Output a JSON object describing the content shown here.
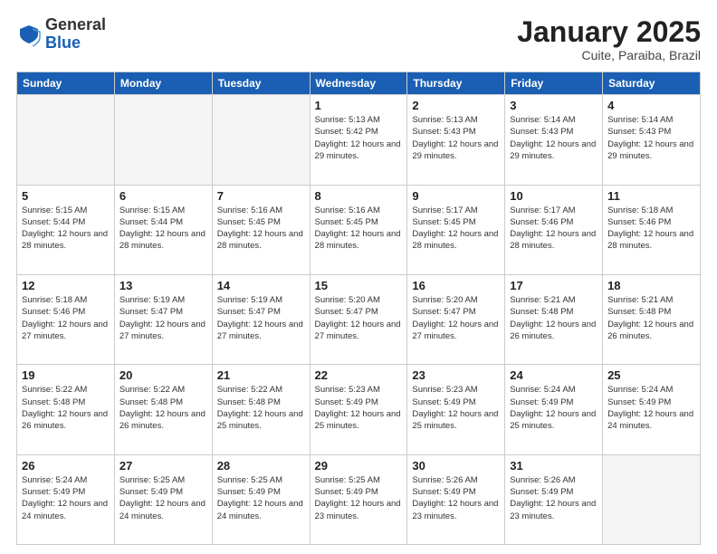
{
  "header": {
    "logo_general": "General",
    "logo_blue": "Blue",
    "month_title": "January 2025",
    "subtitle": "Cuite, Paraiba, Brazil"
  },
  "days_of_week": [
    "Sunday",
    "Monday",
    "Tuesday",
    "Wednesday",
    "Thursday",
    "Friday",
    "Saturday"
  ],
  "weeks": [
    [
      {
        "day": "",
        "sunrise": "",
        "sunset": "",
        "daylight": "",
        "empty": true
      },
      {
        "day": "",
        "sunrise": "",
        "sunset": "",
        "daylight": "",
        "empty": true
      },
      {
        "day": "",
        "sunrise": "",
        "sunset": "",
        "daylight": "",
        "empty": true
      },
      {
        "day": "1",
        "sunrise": "Sunrise: 5:13 AM",
        "sunset": "Sunset: 5:42 PM",
        "daylight": "Daylight: 12 hours and 29 minutes.",
        "empty": false
      },
      {
        "day": "2",
        "sunrise": "Sunrise: 5:13 AM",
        "sunset": "Sunset: 5:43 PM",
        "daylight": "Daylight: 12 hours and 29 minutes.",
        "empty": false
      },
      {
        "day": "3",
        "sunrise": "Sunrise: 5:14 AM",
        "sunset": "Sunset: 5:43 PM",
        "daylight": "Daylight: 12 hours and 29 minutes.",
        "empty": false
      },
      {
        "day": "4",
        "sunrise": "Sunrise: 5:14 AM",
        "sunset": "Sunset: 5:43 PM",
        "daylight": "Daylight: 12 hours and 29 minutes.",
        "empty": false
      }
    ],
    [
      {
        "day": "5",
        "sunrise": "Sunrise: 5:15 AM",
        "sunset": "Sunset: 5:44 PM",
        "daylight": "Daylight: 12 hours and 28 minutes.",
        "empty": false
      },
      {
        "day": "6",
        "sunrise": "Sunrise: 5:15 AM",
        "sunset": "Sunset: 5:44 PM",
        "daylight": "Daylight: 12 hours and 28 minutes.",
        "empty": false
      },
      {
        "day": "7",
        "sunrise": "Sunrise: 5:16 AM",
        "sunset": "Sunset: 5:45 PM",
        "daylight": "Daylight: 12 hours and 28 minutes.",
        "empty": false
      },
      {
        "day": "8",
        "sunrise": "Sunrise: 5:16 AM",
        "sunset": "Sunset: 5:45 PM",
        "daylight": "Daylight: 12 hours and 28 minutes.",
        "empty": false
      },
      {
        "day": "9",
        "sunrise": "Sunrise: 5:17 AM",
        "sunset": "Sunset: 5:45 PM",
        "daylight": "Daylight: 12 hours and 28 minutes.",
        "empty": false
      },
      {
        "day": "10",
        "sunrise": "Sunrise: 5:17 AM",
        "sunset": "Sunset: 5:46 PM",
        "daylight": "Daylight: 12 hours and 28 minutes.",
        "empty": false
      },
      {
        "day": "11",
        "sunrise": "Sunrise: 5:18 AM",
        "sunset": "Sunset: 5:46 PM",
        "daylight": "Daylight: 12 hours and 28 minutes.",
        "empty": false
      }
    ],
    [
      {
        "day": "12",
        "sunrise": "Sunrise: 5:18 AM",
        "sunset": "Sunset: 5:46 PM",
        "daylight": "Daylight: 12 hours and 27 minutes.",
        "empty": false
      },
      {
        "day": "13",
        "sunrise": "Sunrise: 5:19 AM",
        "sunset": "Sunset: 5:47 PM",
        "daylight": "Daylight: 12 hours and 27 minutes.",
        "empty": false
      },
      {
        "day": "14",
        "sunrise": "Sunrise: 5:19 AM",
        "sunset": "Sunset: 5:47 PM",
        "daylight": "Daylight: 12 hours and 27 minutes.",
        "empty": false
      },
      {
        "day": "15",
        "sunrise": "Sunrise: 5:20 AM",
        "sunset": "Sunset: 5:47 PM",
        "daylight": "Daylight: 12 hours and 27 minutes.",
        "empty": false
      },
      {
        "day": "16",
        "sunrise": "Sunrise: 5:20 AM",
        "sunset": "Sunset: 5:47 PM",
        "daylight": "Daylight: 12 hours and 27 minutes.",
        "empty": false
      },
      {
        "day": "17",
        "sunrise": "Sunrise: 5:21 AM",
        "sunset": "Sunset: 5:48 PM",
        "daylight": "Daylight: 12 hours and 26 minutes.",
        "empty": false
      },
      {
        "day": "18",
        "sunrise": "Sunrise: 5:21 AM",
        "sunset": "Sunset: 5:48 PM",
        "daylight": "Daylight: 12 hours and 26 minutes.",
        "empty": false
      }
    ],
    [
      {
        "day": "19",
        "sunrise": "Sunrise: 5:22 AM",
        "sunset": "Sunset: 5:48 PM",
        "daylight": "Daylight: 12 hours and 26 minutes.",
        "empty": false
      },
      {
        "day": "20",
        "sunrise": "Sunrise: 5:22 AM",
        "sunset": "Sunset: 5:48 PM",
        "daylight": "Daylight: 12 hours and 26 minutes.",
        "empty": false
      },
      {
        "day": "21",
        "sunrise": "Sunrise: 5:22 AM",
        "sunset": "Sunset: 5:48 PM",
        "daylight": "Daylight: 12 hours and 25 minutes.",
        "empty": false
      },
      {
        "day": "22",
        "sunrise": "Sunrise: 5:23 AM",
        "sunset": "Sunset: 5:49 PM",
        "daylight": "Daylight: 12 hours and 25 minutes.",
        "empty": false
      },
      {
        "day": "23",
        "sunrise": "Sunrise: 5:23 AM",
        "sunset": "Sunset: 5:49 PM",
        "daylight": "Daylight: 12 hours and 25 minutes.",
        "empty": false
      },
      {
        "day": "24",
        "sunrise": "Sunrise: 5:24 AM",
        "sunset": "Sunset: 5:49 PM",
        "daylight": "Daylight: 12 hours and 25 minutes.",
        "empty": false
      },
      {
        "day": "25",
        "sunrise": "Sunrise: 5:24 AM",
        "sunset": "Sunset: 5:49 PM",
        "daylight": "Daylight: 12 hours and 24 minutes.",
        "empty": false
      }
    ],
    [
      {
        "day": "26",
        "sunrise": "Sunrise: 5:24 AM",
        "sunset": "Sunset: 5:49 PM",
        "daylight": "Daylight: 12 hours and 24 minutes.",
        "empty": false
      },
      {
        "day": "27",
        "sunrise": "Sunrise: 5:25 AM",
        "sunset": "Sunset: 5:49 PM",
        "daylight": "Daylight: 12 hours and 24 minutes.",
        "empty": false
      },
      {
        "day": "28",
        "sunrise": "Sunrise: 5:25 AM",
        "sunset": "Sunset: 5:49 PM",
        "daylight": "Daylight: 12 hours and 24 minutes.",
        "empty": false
      },
      {
        "day": "29",
        "sunrise": "Sunrise: 5:25 AM",
        "sunset": "Sunset: 5:49 PM",
        "daylight": "Daylight: 12 hours and 23 minutes.",
        "empty": false
      },
      {
        "day": "30",
        "sunrise": "Sunrise: 5:26 AM",
        "sunset": "Sunset: 5:49 PM",
        "daylight": "Daylight: 12 hours and 23 minutes.",
        "empty": false
      },
      {
        "day": "31",
        "sunrise": "Sunrise: 5:26 AM",
        "sunset": "Sunset: 5:49 PM",
        "daylight": "Daylight: 12 hours and 23 minutes.",
        "empty": false
      },
      {
        "day": "",
        "sunrise": "",
        "sunset": "",
        "daylight": "",
        "empty": true
      }
    ]
  ]
}
